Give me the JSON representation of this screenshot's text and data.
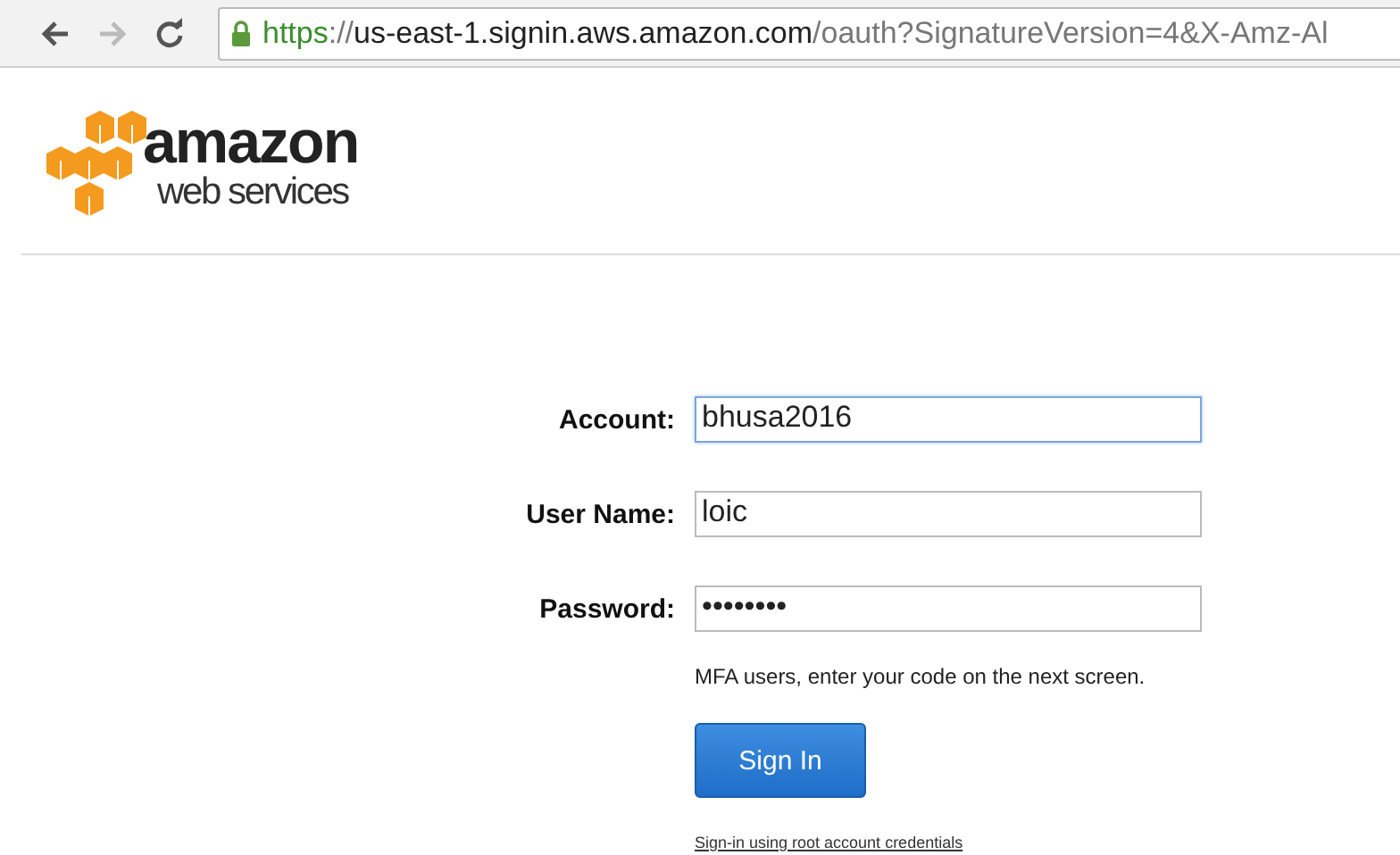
{
  "browser": {
    "url": {
      "scheme": "https",
      "separator": "://",
      "host": "us-east-1.signin.aws.amazon.com",
      "path": "/oauth?SignatureVersion=4&X-Amz-Al"
    },
    "secure": true
  },
  "logo": {
    "wordmark": "amazon",
    "tagline": "web services"
  },
  "form": {
    "fields": [
      {
        "label": "Account:",
        "value": "bhusa2016",
        "focused": true
      },
      {
        "label": "User Name:",
        "value": "loic",
        "focused": false
      },
      {
        "label": "Password:",
        "value": "••••••••",
        "focused": false
      }
    ],
    "note": "MFA users, enter your code on the next screen.",
    "submit": "Sign In",
    "link": "Sign-in using root account credentials"
  }
}
